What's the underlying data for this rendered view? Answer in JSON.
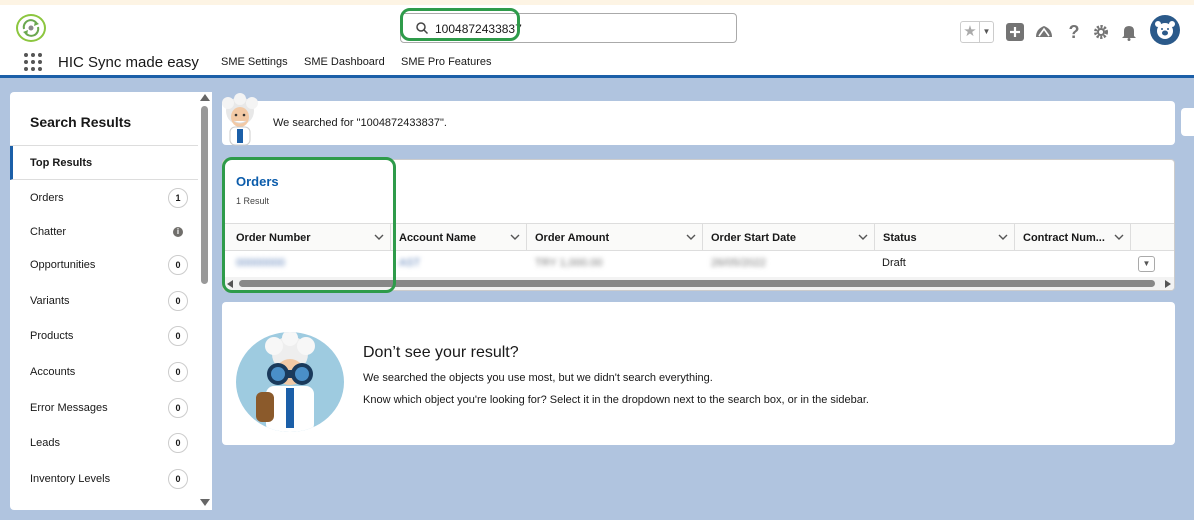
{
  "header": {
    "search": {
      "value": "1004872433837"
    },
    "icons": [
      "favorites-star-icon",
      "add-icon",
      "trailhead-icon",
      "help-icon",
      "setup-gear-icon",
      "notifications-bell-icon",
      "user-avatar"
    ]
  },
  "nav": {
    "app_name": "HIC Sync made easy",
    "items": [
      {
        "label": "SME Settings"
      },
      {
        "label": "SME Dashboard"
      },
      {
        "label": "SME Pro Features"
      }
    ]
  },
  "sidebar": {
    "title": "Search Results",
    "top_results": "Top Results",
    "items": [
      {
        "label": "Orders",
        "count": "1"
      },
      {
        "label": "Chatter",
        "count": ""
      },
      {
        "label": "Opportunities",
        "count": "0"
      },
      {
        "label": "Variants",
        "count": "0"
      },
      {
        "label": "Products",
        "count": "0"
      },
      {
        "label": "Accounts",
        "count": "0"
      },
      {
        "label": "Error Messages",
        "count": "0"
      },
      {
        "label": "Leads",
        "count": "0"
      },
      {
        "label": "Inventory Levels",
        "count": "0"
      }
    ]
  },
  "banner": {
    "text": "We searched for \"1004872433837\"."
  },
  "orders": {
    "title": "Orders",
    "count_text": "1 Result",
    "columns": [
      "Order Number",
      "Account Name",
      "Order Amount",
      "Order Start Date",
      "Status",
      "Contract Num..."
    ],
    "row": {
      "order_number": "00000000",
      "account_name": "AST",
      "order_amount": "TRY 1,000.00",
      "order_start_date": "26/05/2022",
      "status": "Draft"
    }
  },
  "no_result": {
    "title": "Don’t see your result?",
    "line1": "We searched the objects you use most, but we didn't search everything.",
    "line2": "Know which object you're looking for? Select it in the dropdown next to the search box, or in the sidebar."
  },
  "colors": {
    "brand_blue": "#0b5cab",
    "highlight_green": "#2e9b4a",
    "background": "#b0c4df"
  }
}
